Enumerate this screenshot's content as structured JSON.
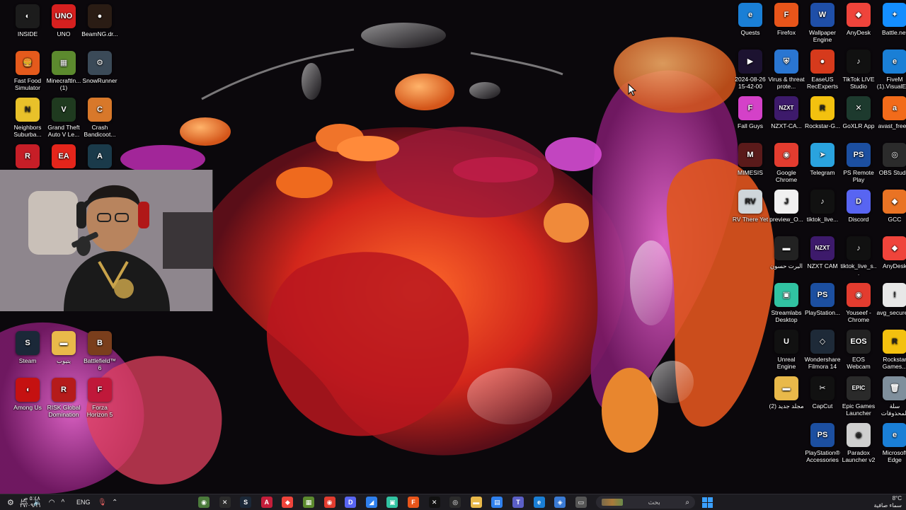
{
  "desktop": {
    "left_icons": [
      {
        "label": "INSIDE",
        "glyph": "◐",
        "bg": "#1c1c1c"
      },
      {
        "label": "UNO",
        "glyph": "UNO",
        "bg": "#d6201f"
      },
      {
        "label": "BeamNG.dr...",
        "glyph": "●",
        "bg": "#2a1c14"
      },
      {
        "label": "Fast Food Simulator",
        "glyph": "🍔",
        "bg": "#e55a1c"
      },
      {
        "label": "Minecraftln... (1)",
        "glyph": "▦",
        "bg": "#5c8a2e"
      },
      {
        "label": "SnowRunner",
        "glyph": "⚙",
        "bg": "#3b4a58"
      },
      {
        "label": "Neighbors Suburba...",
        "glyph": "N",
        "bg": "#e8c12a"
      },
      {
        "label": "Grand Theft Auto V Le...",
        "glyph": "V",
        "bg": "#1f3a1f"
      },
      {
        "label": "Crash Bandicoot...",
        "glyph": "C",
        "bg": "#d8782a"
      },
      {
        "label": "",
        "glyph": "R",
        "bg": "#c61e27"
      },
      {
        "label": "",
        "glyph": "EA",
        "bg": "#e4251b"
      },
      {
        "label": "",
        "glyph": "A",
        "bg": "#1a3a4a"
      },
      {
        "label": "Steam",
        "glyph": "S",
        "bg": "#1b2838"
      },
      {
        "label": "يتيوب",
        "glyph": "▬",
        "bg": "#e9b94a"
      },
      {
        "label": "Battlefield™ 6",
        "glyph": "B",
        "bg": "#7a3e1c"
      },
      {
        "label": "Among Us",
        "glyph": "◖",
        "bg": "#c51111"
      },
      {
        "label": "RISK Global Domination",
        "glyph": "R",
        "bg": "#b51b1b"
      },
      {
        "label": "Forza Horizon 5",
        "glyph": "F",
        "bg": "#c0183a"
      }
    ],
    "right_icons": [
      {
        "label": "Quests",
        "glyph": "e",
        "bg": "#1a7fd6"
      },
      {
        "label": "Firefox",
        "glyph": "F",
        "bg": "#e8551a"
      },
      {
        "label": "Wallpaper Engine",
        "glyph": "W",
        "bg": "#1f4fa8"
      },
      {
        "label": "AnyDesk",
        "glyph": "◆",
        "bg": "#ef443b"
      },
      {
        "label": "Battle.net",
        "glyph": "✦",
        "bg": "#148eff"
      },
      {
        "label": "2024-08-26 15-42-00",
        "glyph": "▶",
        "bg": "#1c1230"
      },
      {
        "label": "Virus & threat prote...",
        "glyph": "⛨",
        "bg": "#2a76d2"
      },
      {
        "label": "EaseUS RecExperts",
        "glyph": "●",
        "bg": "#d63a1c"
      },
      {
        "label": "TikTok LIVE Studio",
        "glyph": "♪",
        "bg": "#111"
      },
      {
        "label": "FiveM (1).VisualEl...",
        "glyph": "e",
        "bg": "#1a7fd6"
      },
      {
        "label": "Fall Guys",
        "glyph": "F",
        "bg": "#d441c8"
      },
      {
        "label": "NZXT-CA...",
        "glyph": "NZXT",
        "bg": "#3d1a6b"
      },
      {
        "label": "Rockstar-G...",
        "glyph": "R",
        "bg": "#f3c10f"
      },
      {
        "label": "GoXLR App",
        "glyph": "✕",
        "bg": "#1d3a2e"
      },
      {
        "label": "avast_free...",
        "glyph": "a",
        "bg": "#f26b1a"
      },
      {
        "label": "MIMESIS",
        "glyph": "M",
        "bg": "#5a1a1a"
      },
      {
        "label": "Google Chrome",
        "glyph": "◉",
        "bg": "#e33c2f"
      },
      {
        "label": "Telegram",
        "glyph": "➤",
        "bg": "#2aa3de"
      },
      {
        "label": "PS Remote Play",
        "glyph": "PS",
        "bg": "#1c4fa0"
      },
      {
        "label": "OBS Studio",
        "glyph": "◎",
        "bg": "#2b2b2b"
      },
      {
        "label": "RV There Yet",
        "glyph": "RV",
        "bg": "#cfd6da"
      },
      {
        "label": "preview_O...",
        "glyph": "J",
        "bg": "#f1f1f1"
      },
      {
        "label": "tiktok_live...",
        "glyph": "♪",
        "bg": "#111"
      },
      {
        "label": "Discord",
        "glyph": "D",
        "bg": "#5865f2"
      },
      {
        "label": "GCC",
        "glyph": "◆",
        "bg": "#e97324"
      },
      {
        "label": "البرت حسون",
        "glyph": "▬",
        "bg": "#222"
      },
      {
        "label": "NZXT CAM",
        "glyph": "NZXT",
        "bg": "#3d1a6b"
      },
      {
        "label": "tiktok_live_s...",
        "glyph": "♪",
        "bg": "#111"
      },
      {
        "label": "AnyDesk",
        "glyph": "◆",
        "bg": "#ef443b"
      },
      {
        "label": "Streamlabs Desktop",
        "glyph": "▣",
        "bg": "#31c3a2"
      },
      {
        "label": "PlayStation...",
        "glyph": "PS",
        "bg": "#1c4fa0"
      },
      {
        "label": "Youseef - Chrome",
        "glyph": "◉",
        "bg": "#e33c2f"
      },
      {
        "label": "avg_secure...",
        "glyph": "!",
        "bg": "#e8e8e8"
      },
      {
        "label": "Unreal Engine",
        "glyph": "U",
        "bg": "#111"
      },
      {
        "label": "Wondershare Filmora 14",
        "glyph": "◇",
        "bg": "#1e2a38"
      },
      {
        "label": "EOS Webcam Utility Pro",
        "glyph": "EOS",
        "bg": "#222"
      },
      {
        "label": "Rockstar Games...",
        "glyph": "R",
        "bg": "#f3c10f"
      },
      {
        "label": "مجلد جديد (2)",
        "glyph": "▬",
        "bg": "#e9b94a"
      },
      {
        "label": "CapCut",
        "glyph": "✂",
        "bg": "#111"
      },
      {
        "label": "Epic Games Launcher",
        "glyph": "EPIC",
        "bg": "#2a2a2a"
      },
      {
        "label": "سلة المحذوفات",
        "glyph": "🗑",
        "bg": "#7f8f9c"
      },
      {
        "label": "PlayStation® Accessories",
        "glyph": "PS",
        "bg": "#1c4fa0"
      },
      {
        "label": "Paradox Launcher v2",
        "glyph": "◉",
        "bg": "#cfcfcf"
      },
      {
        "label": "Microsoft Edge",
        "glyph": "e",
        "bg": "#1a7fd6"
      }
    ]
  },
  "webcam": {
    "label": "webcam-overlay"
  },
  "taskbar": {
    "apps": [
      {
        "name": "explorer-app-icon",
        "glyph": "◉",
        "bg": "#4b7a3b"
      },
      {
        "name": "xbox-app-icon",
        "glyph": "✕",
        "bg": "#2b2b2b"
      },
      {
        "name": "steam-app-icon",
        "glyph": "S",
        "bg": "#1b2838"
      },
      {
        "name": "affinity-app-icon",
        "glyph": "A",
        "bg": "#c41e3a"
      },
      {
        "name": "anydesk-app-icon",
        "glyph": "◆",
        "bg": "#ef443b"
      },
      {
        "name": "minecraft-app-icon",
        "glyph": "▦",
        "bg": "#5c8a2e"
      },
      {
        "name": "chrome-app-icon",
        "glyph": "◉",
        "bg": "#e33c2f"
      },
      {
        "name": "discord-app-icon",
        "glyph": "D",
        "bg": "#5865f2"
      },
      {
        "name": "vscode-app-icon",
        "glyph": "◢",
        "bg": "#2f80ed"
      },
      {
        "name": "streamlabs-app-icon",
        "glyph": "▣",
        "bg": "#31c3a2"
      },
      {
        "name": "firefox-app-icon",
        "glyph": "F",
        "bg": "#e8551a"
      },
      {
        "name": "capcut-app-icon",
        "glyph": "✕",
        "bg": "#111"
      },
      {
        "name": "obs-app-icon",
        "glyph": "◎",
        "bg": "#2b2b2b"
      },
      {
        "name": "folder-app-icon",
        "glyph": "▬",
        "bg": "#e9b94a"
      },
      {
        "name": "store-app-icon",
        "glyph": "▤",
        "bg": "#2f80ed"
      },
      {
        "name": "teams-app-icon",
        "glyph": "T",
        "bg": "#5b5fc7"
      },
      {
        "name": "edge-app-icon",
        "glyph": "e",
        "bg": "#1a7fd6"
      },
      {
        "name": "tailscale-app-icon",
        "glyph": "◈",
        "bg": "#3a7bd5"
      },
      {
        "name": "window-app-icon",
        "glyph": "▭",
        "bg": "#555"
      }
    ],
    "search_placeholder": "بحث",
    "weather": {
      "temp": "8°C",
      "text": "سماء صافية"
    },
    "clock": {
      "time": "٥:٤٨ ص",
      "date": "٢٧/٠٩/١١"
    },
    "lang": "ENG"
  }
}
